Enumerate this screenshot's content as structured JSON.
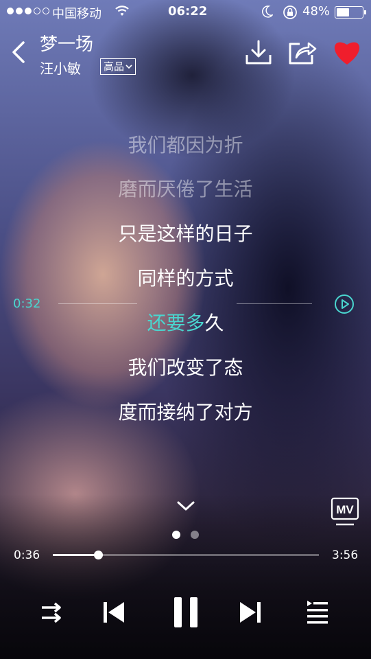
{
  "status_bar": {
    "signal_bars": 5,
    "signal_filled": 3,
    "carrier": "中国移动",
    "time": "06:22",
    "battery_percent": "48%",
    "battery_level": 0.48
  },
  "header": {
    "title": "梦一场",
    "artist": "汪小敏",
    "quality_label": "高品"
  },
  "lyrics": {
    "lines": [
      "我们都因为折",
      "磨而厌倦了生活",
      "只是这样的日子",
      "同样的方式"
    ],
    "current_sung": "还要多",
    "current_rest": "久",
    "after": [
      "我们改变了态",
      "度而接纳了对方"
    ]
  },
  "lyric_seek": {
    "time": "0:32"
  },
  "mv_label": "MV",
  "pager": {
    "count": 2,
    "active_index": 0
  },
  "progress": {
    "current": "0:36",
    "total": "3:56",
    "fraction": 0.17
  },
  "colors": {
    "accent": "#4ad6cf",
    "favorite": "#f01e2c"
  },
  "icons": {
    "back": "chevron-left-icon",
    "download": "download-icon",
    "share": "share-icon",
    "favorite": "heart-icon",
    "play_from_lyric": "play-circle-icon",
    "collapse": "chevron-down-icon",
    "shuffle": "shuffle-icon",
    "previous": "previous-icon",
    "pause": "pause-icon",
    "next": "next-icon",
    "playlist": "playlist-icon"
  }
}
